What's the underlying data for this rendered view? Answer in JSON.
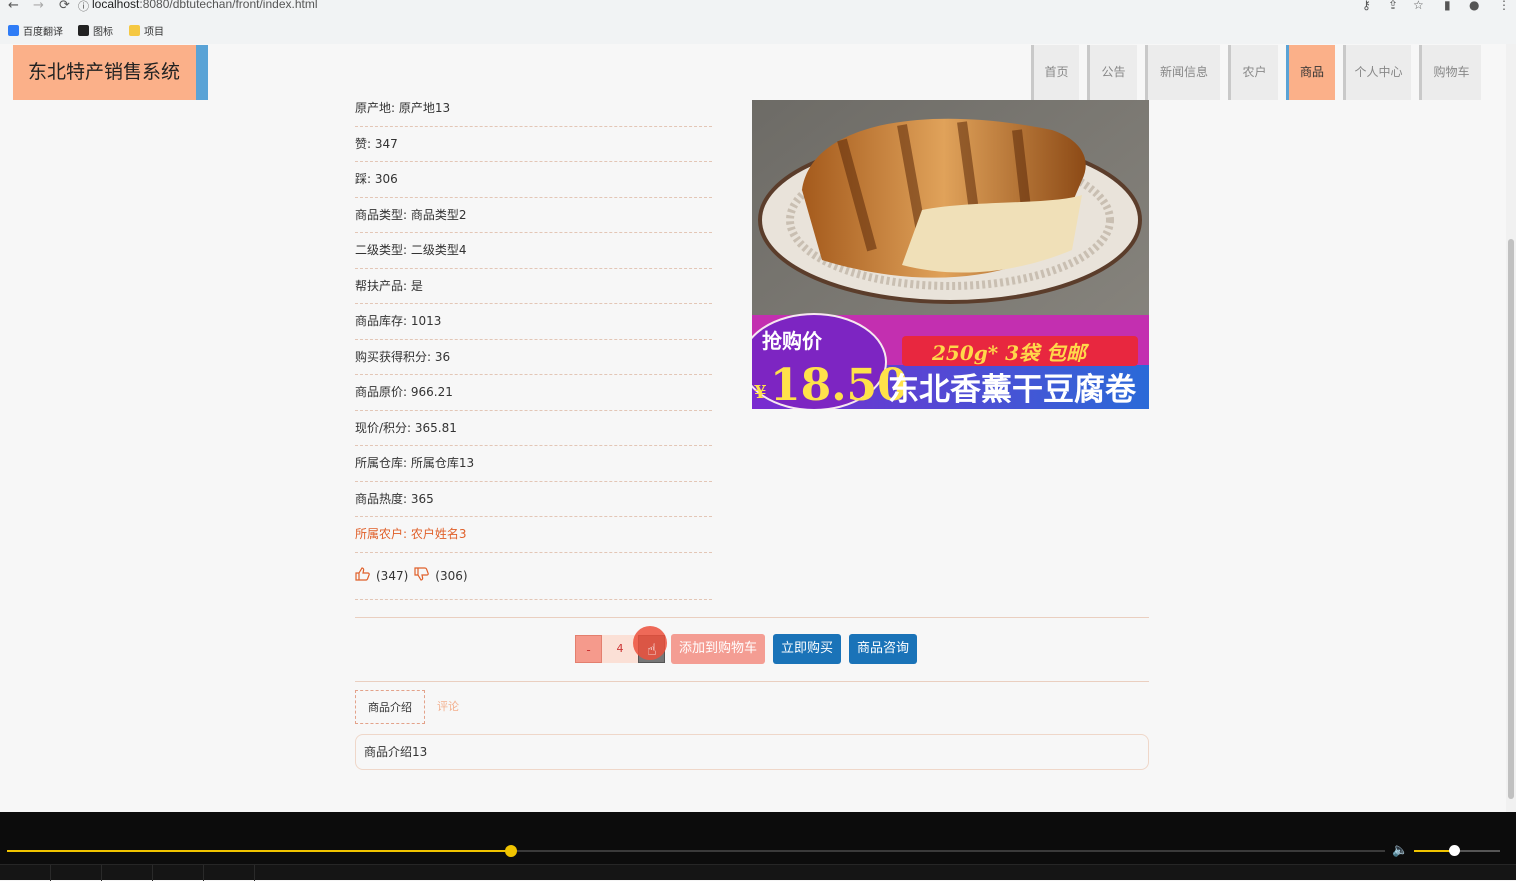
{
  "browser": {
    "url_host": "localhost",
    "url_rest": ":8080/dbtutechan/front/index.html",
    "bookmarks": [
      "百度翻译",
      "图标",
      "项目"
    ]
  },
  "header": {
    "brand": "东北特产销售系统",
    "nav": [
      "首页",
      "公告",
      "新闻信息",
      "农户",
      "商品",
      "个人中心",
      "购物车"
    ],
    "active_index": 4
  },
  "details": [
    {
      "label": "原产地",
      "value": "原产地13"
    },
    {
      "label": "赞",
      "value": "347"
    },
    {
      "label": "踩",
      "value": "306"
    },
    {
      "label": "商品类型",
      "value": "商品类型2"
    },
    {
      "label": "二级类型",
      "value": "二级类型4"
    },
    {
      "label": "帮扶产品",
      "value": "是"
    },
    {
      "label": "商品库存",
      "value": "1013"
    },
    {
      "label": "购买获得积分",
      "value": "36"
    },
    {
      "label": "商品原价",
      "value": "966.21"
    },
    {
      "label": "现价/积分",
      "value": "365.81"
    },
    {
      "label": "所属仓库",
      "value": "所属仓库13"
    },
    {
      "label": "商品热度",
      "value": "365"
    },
    {
      "label": "所属农户",
      "value": "农户姓名3"
    }
  ],
  "votes": {
    "like": "(347)",
    "dislike": "(306)"
  },
  "image": {
    "badge": "抢购价",
    "currency": "¥",
    "price": "18.50",
    "spec": "250g* 3袋  包邮",
    "title": "东北香薰干豆腐卷"
  },
  "buy": {
    "minus": "-",
    "quantity": "4",
    "add_cart": "添加到购物车",
    "buy_now": "立即购买",
    "consult": "商品咨询"
  },
  "tabs": [
    "商品介绍",
    "评论"
  ],
  "intro_text": "商品介绍13",
  "player": {
    "progress": 0.366,
    "volume": 0.47
  }
}
